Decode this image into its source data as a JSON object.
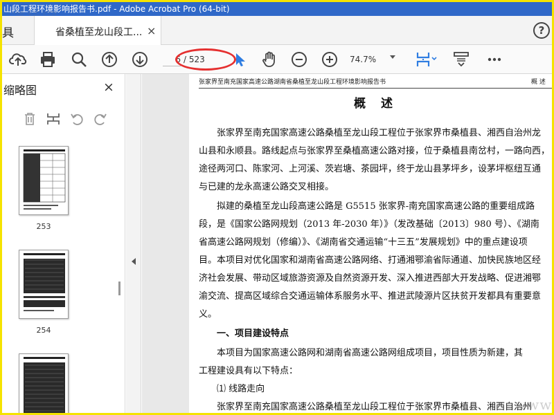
{
  "window": {
    "title": "山段工程环境影响报告书.pdf - Adobe Acrobat Pro (64-bit)",
    "watermark_top": "道桥网",
    "watermark_bottom": "www.cadao.com"
  },
  "tabs": {
    "tools_label": "具",
    "document_tab": "省桑植至龙山段工...",
    "close_glyph": "×",
    "help_glyph": "?"
  },
  "toolbar": {
    "page_current": "6",
    "page_total": "/ 523",
    "zoom": "74.7%",
    "icons": [
      "cloud-upload-icon",
      "print-icon",
      "zoom-search-icon",
      "page-up-icon",
      "page-down-icon",
      "select-arrow-icon",
      "hand-icon",
      "zoom-out-icon",
      "zoom-in-icon",
      "fit-page-icon",
      "scroll-mode-icon",
      "more-icon"
    ]
  },
  "sidebar": {
    "title": "缩略图",
    "close_glyph": "×",
    "thumbnails": [
      {
        "label": "253"
      },
      {
        "label": "254"
      },
      {
        "label": ""
      }
    ]
  },
  "document": {
    "running_head": "张家界至南充国家高速公路湖南省桑植至龙山段工程环境影响报告书",
    "running_head_right": "概 述",
    "heading": "概  述",
    "lines": [
      "　　张家界至南充国家高速公路桑植至龙山段工程位于张家界市桑植县、湘西自治州龙",
      "山县和永顺县。路线起点与张家界至桑植高速公路对接，位于桑植县南岔村，一路向西，",
      "途径两河口、陈家河、上河溪、茨岩塘、茶园坪，终于龙山县茅坪乡，设茅坪枢纽互通",
      "与已建的龙永高速公路交叉相接。",
      "　　拟建的桑植至龙山段高速公路是 G5515 张家界-南充国家高速公路的重要组成路",
      "段，是《国家公路网规划（2013 年-2030 年）》（发改基础〔2013〕980 号）、《湖南",
      "省高速公路网规划（修编）》、《湖南省交通运输“十三五”发展规划》中的重点建设项",
      "目。本项目对优化国家和湖南省高速公路网络、打通湘鄂渝省际通道、加快民族地区经",
      "济社会发展、带动区域旅游资源及自然资源开发、深入推进西部大开发战略、促进湘鄂",
      "渝交流、提高区域综合交通运输体系服务水平、推进武陵源片区扶贫开发都具有重要意",
      "义。"
    ],
    "section_title": "　　一、项目建设特点",
    "lines2": [
      "　　本项目为国家高速公路网和湖南省高速公路网组成项目，项目性质为新建，其",
      "工程建设具有以下特点："
    ],
    "sub_item": "　　⑴ 线路走向",
    "last_line": "　　张家界至南充国家高速公路桑植至龙山段工程位于张家界市桑植县、湘西自治州"
  },
  "colors": {
    "titlebar": "#2f68c8",
    "frame": "#f5e300",
    "annotation": "#e53030",
    "accent": "#2f7de1"
  }
}
